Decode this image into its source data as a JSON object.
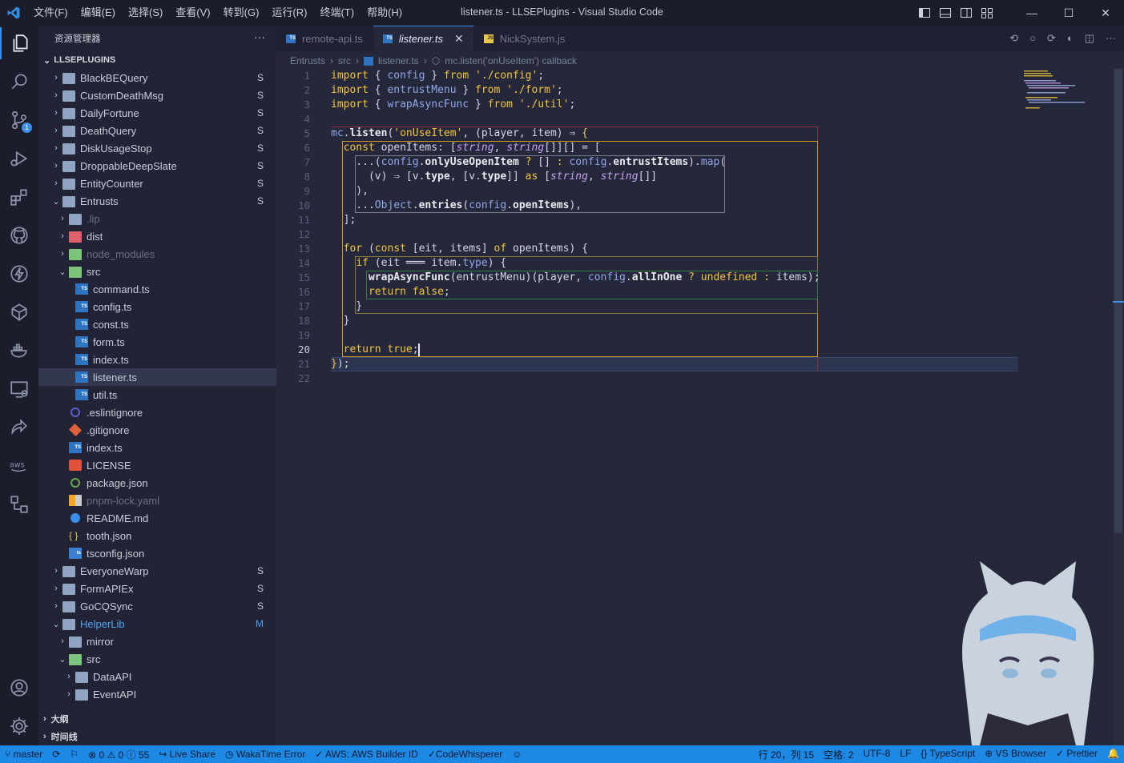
{
  "window": {
    "title": "listener.ts - LLSEPlugins - Visual Studio Code"
  },
  "menu": [
    "文件(F)",
    "编辑(E)",
    "选择(S)",
    "查看(V)",
    "转到(G)",
    "运行(R)",
    "终端(T)",
    "帮助(H)"
  ],
  "accent": "#3b8eea",
  "sidebar": {
    "title": "资源管理器",
    "more": "···",
    "project": "LLSEPLUGINS",
    "items": [
      {
        "label": "BlackBEQuery",
        "status": "S",
        "depth": 0,
        "kind": "folder",
        "open": false
      },
      {
        "label": "CustomDeathMsg",
        "status": "S",
        "depth": 0,
        "kind": "folder",
        "open": false
      },
      {
        "label": "DailyFortune",
        "status": "S",
        "depth": 0,
        "kind": "folder",
        "open": false
      },
      {
        "label": "DeathQuery",
        "status": "S",
        "depth": 0,
        "kind": "folder",
        "open": false
      },
      {
        "label": "DiskUsageStop",
        "status": "S",
        "depth": 0,
        "kind": "folder",
        "open": false
      },
      {
        "label": "DroppableDeepSlate",
        "status": "S",
        "depth": 0,
        "kind": "folder",
        "open": false
      },
      {
        "label": "EntityCounter",
        "status": "S",
        "depth": 0,
        "kind": "folder",
        "open": false
      },
      {
        "label": "Entrusts",
        "status": "S",
        "depth": 0,
        "kind": "folder",
        "open": true
      },
      {
        "label": ".lip",
        "status": "",
        "depth": 1,
        "kind": "folder",
        "open": false,
        "dim": true
      },
      {
        "label": "dist",
        "status": "",
        "depth": 1,
        "kind": "folder-red",
        "open": false
      },
      {
        "label": "node_modules",
        "status": "",
        "depth": 1,
        "kind": "folder-green",
        "open": false,
        "dim": true
      },
      {
        "label": "src",
        "status": "",
        "depth": 1,
        "kind": "folder-green",
        "open": true
      },
      {
        "label": "command.ts",
        "status": "",
        "depth": 2,
        "kind": "ts"
      },
      {
        "label": "config.ts",
        "status": "",
        "depth": 2,
        "kind": "ts"
      },
      {
        "label": "const.ts",
        "status": "",
        "depth": 2,
        "kind": "ts"
      },
      {
        "label": "form.ts",
        "status": "",
        "depth": 2,
        "kind": "ts"
      },
      {
        "label": "index.ts",
        "status": "",
        "depth": 2,
        "kind": "ts"
      },
      {
        "label": "listener.ts",
        "status": "",
        "depth": 2,
        "kind": "ts",
        "selected": true
      },
      {
        "label": "util.ts",
        "status": "",
        "depth": 2,
        "kind": "ts"
      },
      {
        "label": ".eslintignore",
        "status": "",
        "depth": 1,
        "kind": "eslint"
      },
      {
        "label": ".gitignore",
        "status": "",
        "depth": 1,
        "kind": "git"
      },
      {
        "label": "index.ts",
        "status": "",
        "depth": 1,
        "kind": "ts"
      },
      {
        "label": "LICENSE",
        "status": "",
        "depth": 1,
        "kind": "license"
      },
      {
        "label": "package.json",
        "status": "",
        "depth": 1,
        "kind": "node"
      },
      {
        "label": "pnpm-lock.yaml",
        "status": "",
        "depth": 1,
        "kind": "pnpm",
        "dim": true
      },
      {
        "label": "README.md",
        "status": "",
        "depth": 1,
        "kind": "info"
      },
      {
        "label": "tooth.json",
        "status": "",
        "depth": 1,
        "kind": "json"
      },
      {
        "label": "tsconfig.json",
        "status": "",
        "depth": 1,
        "kind": "tsconfig"
      },
      {
        "label": "EveryoneWarp",
        "status": "S",
        "depth": 0,
        "kind": "folder",
        "open": false
      },
      {
        "label": "FormAPIEx",
        "status": "S",
        "depth": 0,
        "kind": "folder",
        "open": false
      },
      {
        "label": "GoCQSync",
        "status": "S",
        "depth": 0,
        "kind": "folder",
        "open": false
      },
      {
        "label": "HelperLib",
        "status": "M",
        "depth": 0,
        "kind": "folder",
        "open": true,
        "modified": true
      },
      {
        "label": "mirror",
        "status": "",
        "depth": 1,
        "kind": "folder",
        "open": false
      },
      {
        "label": "src",
        "status": "",
        "depth": 1,
        "kind": "folder-green",
        "open": true
      },
      {
        "label": "DataAPI",
        "status": "",
        "depth": 2,
        "kind": "folder",
        "open": false
      },
      {
        "label": "EventAPI",
        "status": "",
        "depth": 2,
        "kind": "folder",
        "open": false
      }
    ],
    "outline": "大纲",
    "timeline": "时间线"
  },
  "tabs": [
    {
      "label": "remote-api.ts",
      "icon": "TS",
      "active": false
    },
    {
      "label": "listener.ts",
      "icon": "TS",
      "active": true
    },
    {
      "label": "NickSystem.js",
      "icon": "JS",
      "active": false
    }
  ],
  "breadcrumb": [
    "Entrusts",
    "src",
    "listener.ts",
    "mc.listen('onUseItem') callback"
  ],
  "code": {
    "current_line": 20,
    "lines": [
      [
        [
          "k",
          "import"
        ],
        [
          "p",
          " { "
        ],
        [
          "v",
          "config"
        ],
        [
          "p",
          " } "
        ],
        [
          "k",
          "from"
        ],
        [
          "s",
          " './config'"
        ],
        [
          "p",
          ";"
        ]
      ],
      [
        [
          "k",
          "import"
        ],
        [
          "p",
          " { "
        ],
        [
          "v",
          "entrustMenu"
        ],
        [
          "p",
          " } "
        ],
        [
          "k",
          "from"
        ],
        [
          "s",
          " './form'"
        ],
        [
          "p",
          ";"
        ]
      ],
      [
        [
          "k",
          "import"
        ],
        [
          "p",
          " { "
        ],
        [
          "v",
          "wrapAsyncFunc"
        ],
        [
          "p",
          " } "
        ],
        [
          "k",
          "from"
        ],
        [
          "s",
          " './util'"
        ],
        [
          "p",
          ";"
        ]
      ],
      [],
      [
        [
          "v",
          "mc"
        ],
        [
          "p",
          "."
        ],
        [
          "f",
          "listen"
        ],
        [
          "p",
          "("
        ],
        [
          "s",
          "'onUseItem'"
        ],
        [
          "p",
          ", ("
        ],
        [
          "p",
          "player"
        ],
        [
          "p",
          ", "
        ],
        [
          "p",
          "item"
        ],
        [
          "p",
          ") ⇒ "
        ],
        [
          "b",
          "{"
        ]
      ],
      [
        [
          "p",
          "  "
        ],
        [
          "k",
          "const"
        ],
        [
          "p",
          " openItems"
        ],
        [
          "p",
          ": ["
        ],
        [
          "t",
          "string"
        ],
        [
          "p",
          ", "
        ],
        [
          "t",
          "string"
        ],
        [
          "p",
          "[]][] = ["
        ]
      ],
      [
        [
          "p",
          "    ..."
        ],
        [
          "p",
          "("
        ],
        [
          "v",
          "config"
        ],
        [
          "p",
          "."
        ],
        [
          "f",
          "onlyUseOpenItem"
        ],
        [
          "k",
          " ?"
        ],
        [
          "p",
          " [] "
        ],
        [
          "k",
          ":"
        ],
        [
          "v",
          " config"
        ],
        [
          "p",
          "."
        ],
        [
          "f",
          "entrustItems"
        ],
        [
          "p",
          ")."
        ],
        [
          "v",
          "map"
        ],
        [
          "p",
          "("
        ]
      ],
      [
        [
          "p",
          "      (v) ⇒ [v."
        ],
        [
          "f",
          "type"
        ],
        [
          "p",
          ", [v."
        ],
        [
          "f",
          "type"
        ],
        [
          "p",
          "]] "
        ],
        [
          "k",
          "as"
        ],
        [
          "p",
          " ["
        ],
        [
          "t",
          "string"
        ],
        [
          "p",
          ", "
        ],
        [
          "t",
          "string"
        ],
        [
          "p",
          "[]]"
        ]
      ],
      [
        [
          "p",
          "    ),"
        ]
      ],
      [
        [
          "p",
          "    ..."
        ],
        [
          "v",
          "Object"
        ],
        [
          "p",
          "."
        ],
        [
          "f",
          "entries"
        ],
        [
          "p",
          "("
        ],
        [
          "v",
          "config"
        ],
        [
          "p",
          "."
        ],
        [
          "f",
          "openItems"
        ],
        [
          "p",
          "),"
        ]
      ],
      [
        [
          "p",
          "  ];"
        ]
      ],
      [],
      [
        [
          "p",
          "  "
        ],
        [
          "k",
          "for"
        ],
        [
          "p",
          " ("
        ],
        [
          "k",
          "const"
        ],
        [
          "p",
          " [eit, items] "
        ],
        [
          "k",
          "of"
        ],
        [
          "p",
          " openItems) {"
        ]
      ],
      [
        [
          "p",
          "    "
        ],
        [
          "k",
          "if"
        ],
        [
          "p",
          " (eit ═══ item."
        ],
        [
          "v",
          "type"
        ],
        [
          "p",
          ") {"
        ]
      ],
      [
        [
          "p",
          "      "
        ],
        [
          "f",
          "wrapAsyncFunc"
        ],
        [
          "p",
          "(entrustMenu)(player, "
        ],
        [
          "v",
          "config"
        ],
        [
          "p",
          "."
        ],
        [
          "f",
          "allInOne"
        ],
        [
          "k",
          " ?"
        ],
        [
          "k",
          " undefined"
        ],
        [
          "k",
          " :"
        ],
        [
          "p",
          " items);"
        ]
      ],
      [
        [
          "p",
          "      "
        ],
        [
          "k",
          "return"
        ],
        [
          "k",
          " false"
        ],
        [
          "p",
          ";"
        ]
      ],
      [
        [
          "p",
          "    }"
        ]
      ],
      [
        [
          "p",
          "  }"
        ]
      ],
      [],
      [
        [
          "p",
          "  "
        ],
        [
          "k",
          "return"
        ],
        [
          "k",
          " true"
        ],
        [
          "p",
          ";"
        ]
      ],
      [
        [
          "b",
          "}"
        ],
        [
          "p",
          ");"
        ]
      ],
      []
    ]
  },
  "statusbar": {
    "left": [
      "master",
      "⟳",
      "⚐",
      "⊗ 0 ⚠ 0 ⓘ 55",
      "Live Share",
      "WakaTime Error",
      "✓ AWS: AWS Builder ID",
      "✓CodeWhisperer",
      "☺"
    ],
    "right": [
      "行 20，列 15",
      "空格: 2",
      "UTF-8",
      "LF",
      "{} TypeScript",
      "VS Browser",
      "✓ Prettier",
      "🔔"
    ]
  }
}
